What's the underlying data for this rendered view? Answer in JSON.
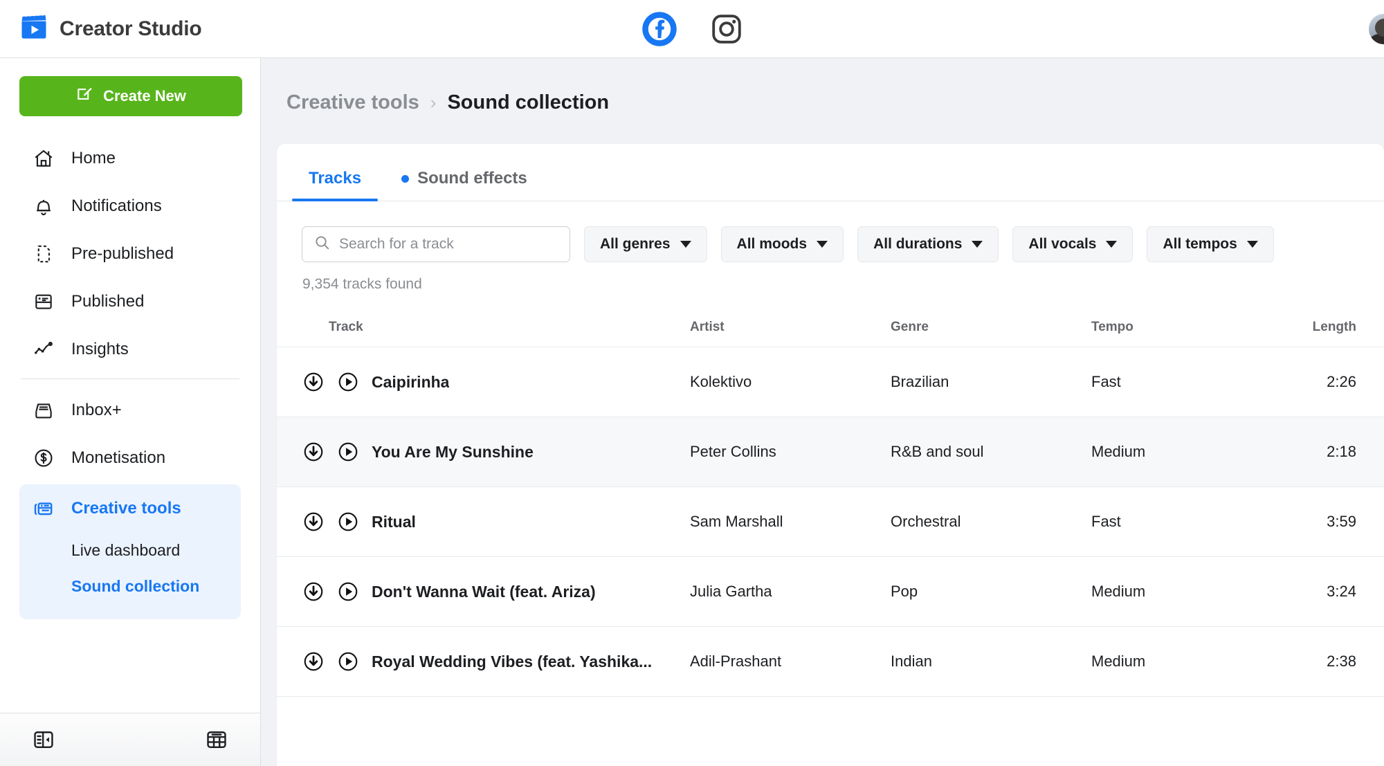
{
  "header": {
    "brand_title": "Creator Studio",
    "logo_icon": "clapperboard-play-icon",
    "platforms": [
      {
        "name": "facebook-icon",
        "label": "Facebook",
        "selected": true
      },
      {
        "name": "instagram-icon",
        "label": "Instagram",
        "selected": false
      }
    ],
    "avatar_icon": "user-avatar"
  },
  "sidebar": {
    "create_button": {
      "label": "Create New",
      "icon": "compose-icon",
      "color": "#57b51b"
    },
    "items": [
      {
        "label": "Home",
        "icon": "home-icon"
      },
      {
        "label": "Notifications",
        "icon": "bell-icon"
      },
      {
        "label": "Pre-published",
        "icon": "draft-document-icon"
      },
      {
        "label": "Published",
        "icon": "post-card-icon"
      },
      {
        "label": "Insights",
        "icon": "insights-chart-icon"
      }
    ],
    "items2": [
      {
        "label": "Inbox+",
        "icon": "inbox-icon"
      },
      {
        "label": "Monetisation",
        "icon": "dollar-circle-icon"
      }
    ],
    "active_group": {
      "label": "Creative tools",
      "icon": "creative-tools-icon",
      "sub_items": [
        {
          "label": "Live dashboard",
          "active": false
        },
        {
          "label": "Sound collection",
          "active": true
        }
      ]
    },
    "footer": {
      "collapse_icon": "collapse-sidebar-icon",
      "grid_icon": "grid-table-icon"
    }
  },
  "breadcrumb": {
    "parent": "Creative tools",
    "separator": "›",
    "current": "Sound collection"
  },
  "tabs": [
    {
      "label": "Tracks",
      "active": true,
      "dot": false
    },
    {
      "label": "Sound effects",
      "active": false,
      "dot": true
    }
  ],
  "search": {
    "placeholder": "Search for a track",
    "value": "",
    "icon": "search-icon"
  },
  "filters": [
    {
      "label": "All genres"
    },
    {
      "label": "All moods"
    },
    {
      "label": "All durations"
    },
    {
      "label": "All vocals"
    },
    {
      "label": "All tempos"
    }
  ],
  "results_count": "9,354 tracks found",
  "table": {
    "columns": [
      "Track",
      "Artist",
      "Genre",
      "Tempo",
      "Length"
    ],
    "rows": [
      {
        "track": "Caipirinha",
        "artist": "Kolektivo",
        "genre": "Brazilian",
        "tempo": "Fast",
        "length": "2:26",
        "highlight": false
      },
      {
        "track": "You Are My Sunshine",
        "artist": "Peter Collins",
        "genre": "R&B and soul",
        "tempo": "Medium",
        "length": "2:18",
        "highlight": true
      },
      {
        "track": "Ritual",
        "artist": "Sam Marshall",
        "genre": "Orchestral",
        "tempo": "Fast",
        "length": "3:59",
        "highlight": false
      },
      {
        "track": "Don't Wanna Wait (feat. Ariza)",
        "artist": "Julia Gartha",
        "genre": "Pop",
        "tempo": "Medium",
        "length": "3:24",
        "highlight": false
      },
      {
        "track": "Royal Wedding Vibes (feat. Yashika...",
        "artist": "Adil-Prashant",
        "genre": "Indian",
        "tempo": "Medium",
        "length": "2:38",
        "highlight": false
      }
    ],
    "row_icons": [
      "download-icon",
      "play-icon"
    ]
  },
  "colors": {
    "accent_blue": "#1877f2",
    "create_green": "#57b51b",
    "page_bg": "#f0f2f5",
    "text_primary": "#1c1e21",
    "text_muted": "#8a8d91"
  }
}
